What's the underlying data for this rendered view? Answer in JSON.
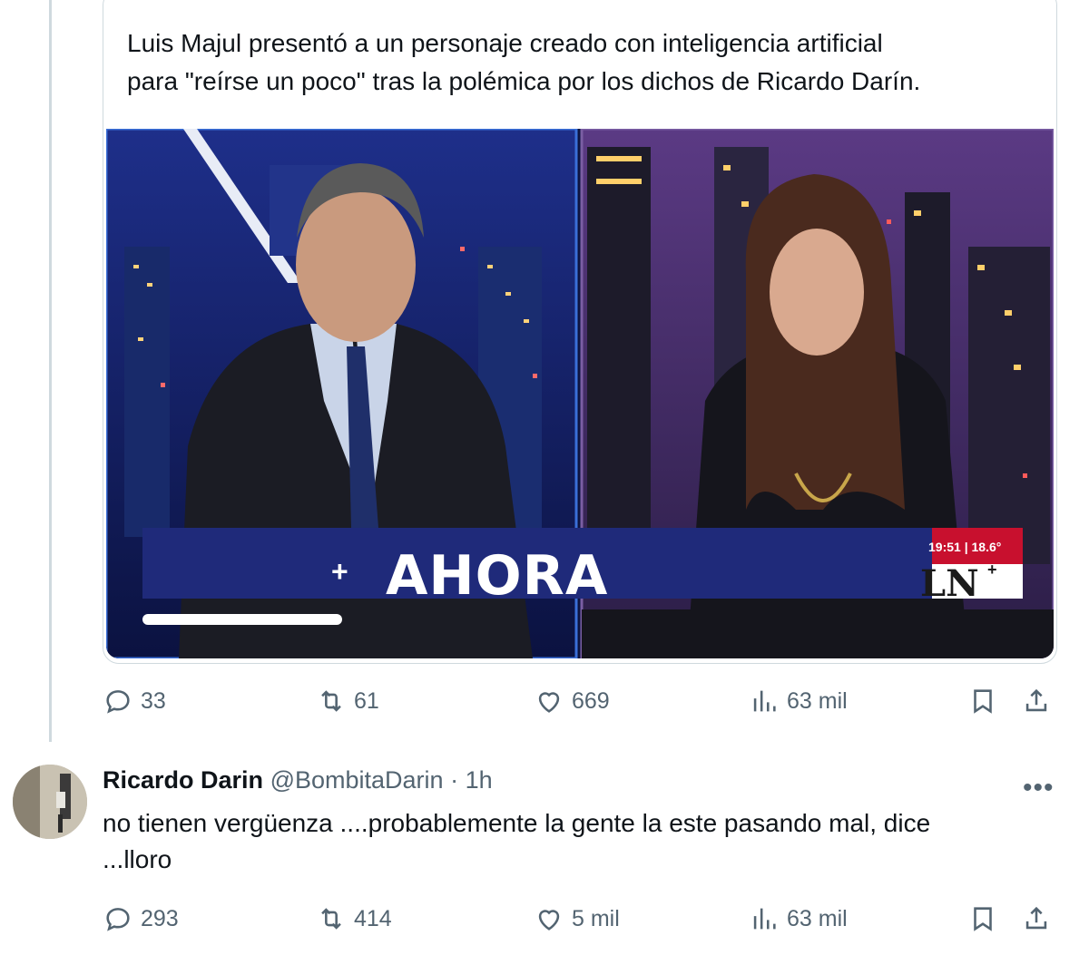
{
  "quoted_card": {
    "text_line1": "Luis Majul presentó a un personaje creado con inteligencia artificial",
    "text_line2": "para \"reírse un poco\" tras la polémica por los dichos de Ricardo Darín.",
    "video": {
      "banner_text": "AHORA",
      "plus": "+",
      "time": "19:51 | 18.6°",
      "channel_logo": "LN",
      "channel_logo_plus": "+"
    }
  },
  "tweet1_actions": {
    "replies": "33",
    "reposts": "61",
    "likes": "669",
    "views": "63 mil"
  },
  "reply": {
    "name": "Ricardo Darin",
    "handle": "@BombitaDarin",
    "separator": "·",
    "time": "1h",
    "text_line1": "no tienen vergüenza ....probablemente la gente la este pasando mal, dice",
    "text_line2": "...lloro",
    "actions": {
      "replies": "293",
      "reposts": "414",
      "likes": "5 mil",
      "views": "63 mil"
    }
  },
  "icons": [
    "reply-icon",
    "repost-icon",
    "like-icon",
    "views-icon",
    "bookmark-icon",
    "share-icon",
    "more-icon",
    "avatar"
  ],
  "colors": {
    "text": "#0f1419",
    "secondary": "#536471",
    "border": "#cfd9de",
    "banner": "#1f2a7a"
  }
}
